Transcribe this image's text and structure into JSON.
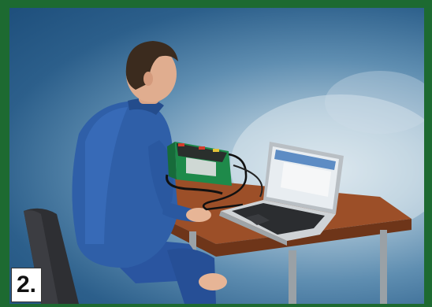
{
  "step_label": "2.",
  "colors": {
    "border": "#1d6a31",
    "sky_dark": "#1e4f7c",
    "sky_light": "#d7e4ec",
    "coverall": "#2f5fa8",
    "table_top": "#a9552c",
    "device_green": "#1e8a4a"
  },
  "icons": {
    "person": "technician-figure",
    "device": "documenting-calibrator",
    "computer": "laptop"
  }
}
